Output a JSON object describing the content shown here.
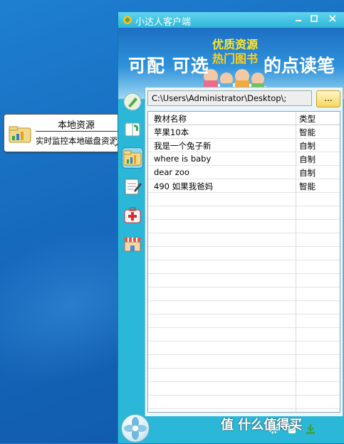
{
  "window": {
    "title": "小达人客户端",
    "controls": [
      "minimize-icon",
      "maximize-icon",
      "close-icon"
    ]
  },
  "banner": {
    "left_text": "可配 可选",
    "tag_line1": "优质资源",
    "tag_line2": "热门图书",
    "right_text": "的点读笔"
  },
  "sidebar": {
    "items": [
      {
        "icon": "pen-device-icon"
      },
      {
        "icon": "book-icon"
      },
      {
        "icon": "local-folder-icon",
        "active": true
      },
      {
        "icon": "notebook-icon"
      },
      {
        "icon": "first-aid-icon"
      },
      {
        "icon": "store-icon"
      }
    ]
  },
  "tooltip": {
    "title": "本地资源",
    "description": "实时监控本地磁盘资源"
  },
  "path": {
    "value": "C:\\Users\\Administrator\\Desktop\\;",
    "browse_label": "..."
  },
  "table": {
    "headers": [
      "教材名称",
      "类型"
    ],
    "rows": [
      {
        "name": "苹果10本",
        "type": "智能"
      },
      {
        "name": "我是一个兔子新",
        "type": "自制"
      },
      {
        "name": "where is baby",
        "type": "自制"
      },
      {
        "name": "dear zoo",
        "type": "自制"
      },
      {
        "name": "490 如果我爸妈",
        "type": "智能"
      }
    ]
  },
  "watermark": "值 什么值得买",
  "colors": {
    "desktop": "#1669bd",
    "window": "#2bb8d8",
    "banner": "#1d6fc4",
    "browse_button": "#f5d860"
  }
}
